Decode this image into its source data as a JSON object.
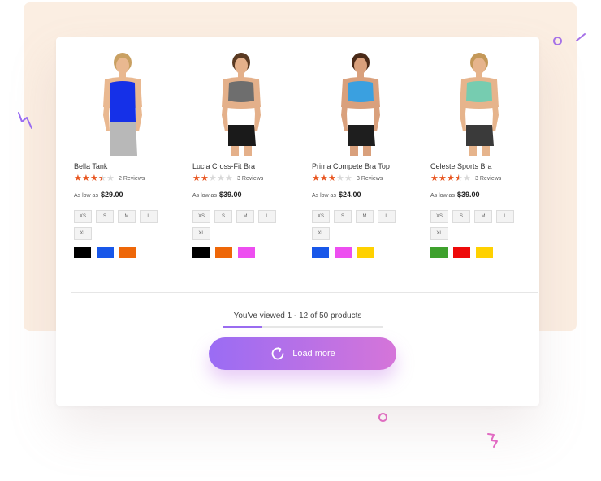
{
  "products": [
    {
      "name": "Bella Tank",
      "rating": 3.5,
      "reviews": "2 Reviews",
      "price_prefix": "As low as",
      "price": "$29.00",
      "image": "woman-in-blue-tank-top",
      "sizes": [
        "XS",
        "S",
        "M",
        "L",
        "XL"
      ],
      "colors": [
        "#000000",
        "#1857e9",
        "#ee6708"
      ]
    },
    {
      "name": "Lucia Cross-Fit Bra",
      "rating": 2,
      "reviews": "3 Reviews",
      "price_prefix": "As low as",
      "price": "$39.00",
      "image": "woman-in-gray-sports-bra",
      "sizes": [
        "XS",
        "S",
        "M",
        "L",
        "XL"
      ],
      "colors": [
        "#000000",
        "#ee6708",
        "#ed4ef0"
      ]
    },
    {
      "name": "Prima Compete Bra Top",
      "rating": 3,
      "reviews": "3 Reviews",
      "price_prefix": "As low as",
      "price": "$24.00",
      "image": "woman-in-blue-bra-top",
      "sizes": [
        "XS",
        "S",
        "M",
        "L",
        "XL"
      ],
      "colors": [
        "#1857e9",
        "#ed4ef0",
        "#ffd100"
      ]
    },
    {
      "name": "Celeste Sports Bra",
      "rating": 3.5,
      "reviews": "3 Reviews",
      "price_prefix": "As low as",
      "price": "$39.00",
      "image": "woman-in-mint-sports-bra",
      "sizes": [
        "XS",
        "S",
        "M",
        "L",
        "XL"
      ],
      "colors": [
        "#3ea12d",
        "#ee0a0a",
        "#ffd100"
      ]
    }
  ],
  "pagination": {
    "viewed_text": "You've viewed 1 - 12 of 50 products",
    "progress": 0.24
  },
  "load_more": {
    "label": "Load more",
    "icon": "refresh-icon"
  },
  "colors": {
    "accent_start": "#9a6cf4",
    "accent_end": "#d575d9",
    "star": "#e8541e",
    "background_panel": "#fbeee2"
  }
}
